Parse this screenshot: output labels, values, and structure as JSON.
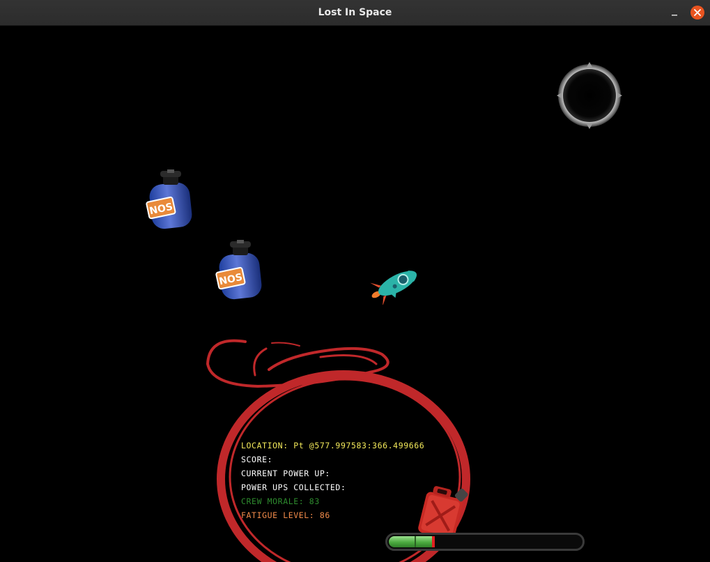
{
  "window": {
    "title": "Lost In Space"
  },
  "hud": {
    "location": "LOCATION: Pt @577.997583:366.499666",
    "score": "SCORE:",
    "current_power_up": "CURRENT POWER UP:",
    "power_ups_collected": "POWER UPS COLLECTED:",
    "crew_morale": "CREW MORALE: 83",
    "fatigue_level": "FATIGUE LEVEL: 86"
  },
  "fuel": {
    "level": 0.24
  },
  "colors": {
    "location_text": "#f2e85a",
    "default_text": "#ffffff",
    "crew_morale_text": "#2e8b2e",
    "fatigue_text": "#f08a4a",
    "close_button": "#e95420",
    "ornament": "#c0282a"
  },
  "icons": [
    "minimize-icon",
    "close-icon",
    "portal-icon",
    "nos-bottle-icon",
    "rocket-icon",
    "fuel-can-icon"
  ]
}
